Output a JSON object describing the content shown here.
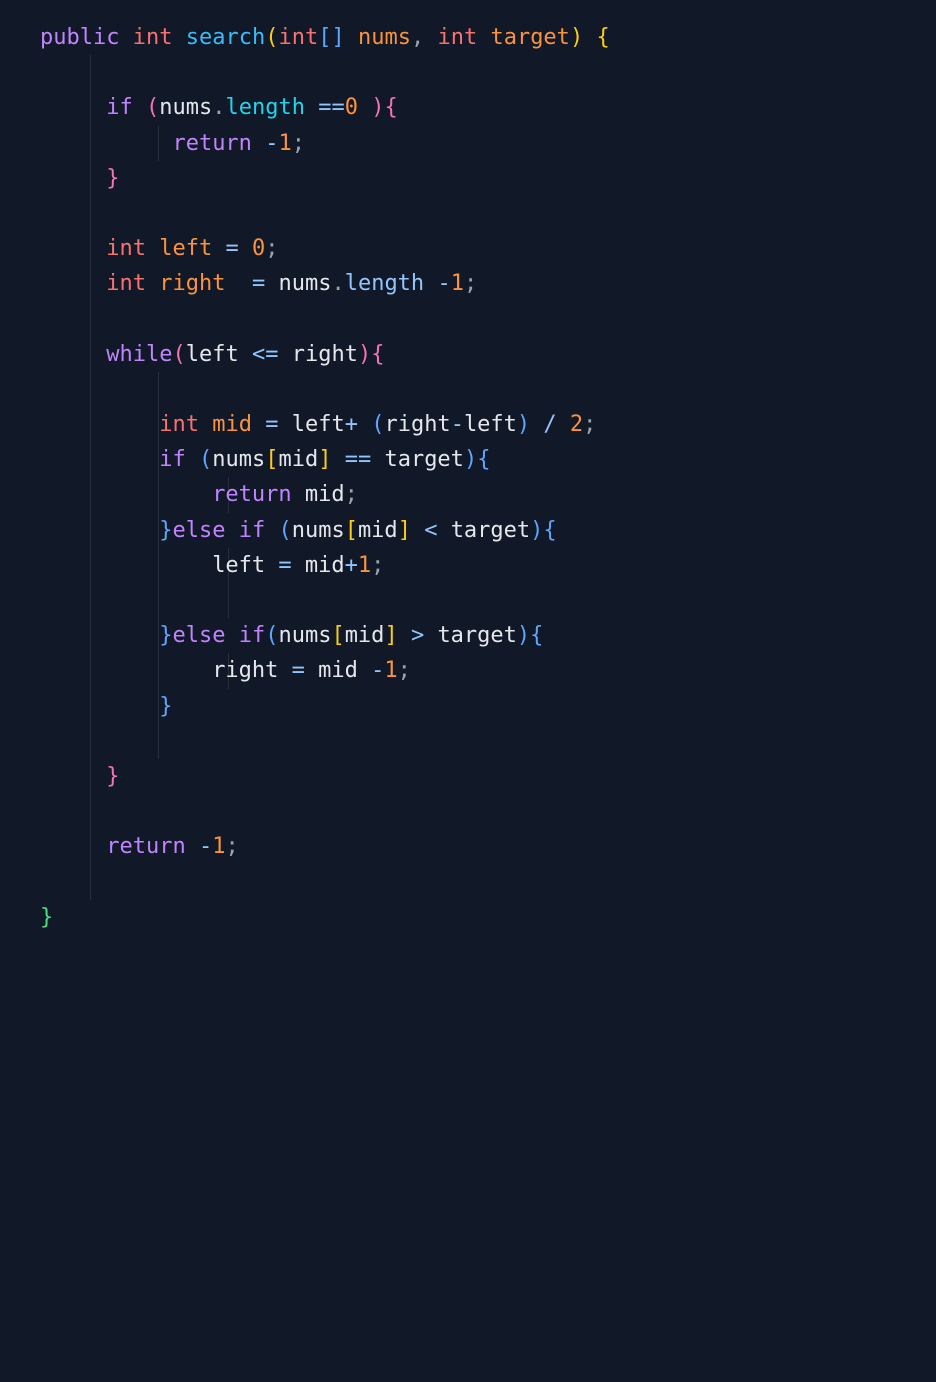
{
  "code": {
    "keywords": {
      "public": "public",
      "int": "int",
      "if": "if",
      "else": "else",
      "return": "return",
      "while": "while"
    },
    "identifiers": {
      "search": "search",
      "nums": "nums",
      "target": "target",
      "left": "left",
      "right": "right",
      "mid": "mid",
      "length": "length"
    },
    "numbers": {
      "zero": "0",
      "one": "1",
      "two": "2",
      "neg_one": "-1"
    },
    "operators": {
      "eq": "=",
      "eqeq": "==",
      "lte": "<=",
      "lt": "<",
      "gt": ">",
      "plus": "+",
      "minus": "-",
      "div": "/"
    },
    "brackets": {
      "lparen": "(",
      "rparen": ")",
      "lbrace": "{",
      "rbrace": "}",
      "lbracket": "[",
      "rbracket": "]"
    },
    "punct": {
      "comma": ",",
      "semi": ";",
      "dot": "."
    }
  }
}
